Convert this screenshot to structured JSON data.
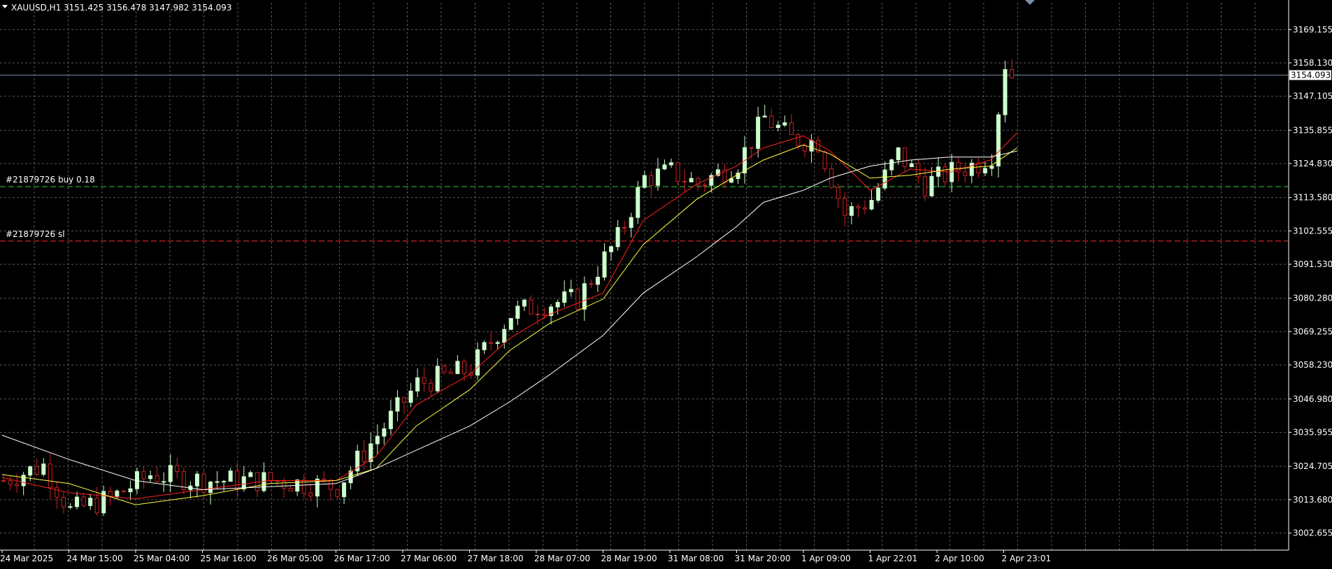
{
  "header": {
    "symbol_label": "XAUUSD,H1",
    "ohlc_label": "3151.425 3156.478 3147.982 3154.093"
  },
  "colors": {
    "background": "#000000",
    "grid": "#5a5a5a",
    "frame": "#ffffff",
    "bull_candle": "#ccffcc",
    "bear_candle": "#cc2222",
    "ma_fast": "#ff2020",
    "ma_mid": "#ffff40",
    "ma_slow": "#ffffff",
    "bid_line": "#7a8ca6",
    "buy_line": "#2ecc40",
    "sl_line": "#ff2a2a"
  },
  "orders": {
    "buy_label": "#21879726 buy 0.18",
    "buy_price": 3117.2,
    "sl_label": "#21879726 sl",
    "sl_price": 3099.2
  },
  "chart_data": {
    "type": "candlestick",
    "symbol": "XAUUSD",
    "timeframe": "H1",
    "current_price": 3154.093,
    "current_price_label": "3154.093",
    "ylim": [
      2997.0,
      3178.0
    ],
    "bar_count": 195,
    "price_ticks": [
      "3169.155",
      "3158.130",
      "3147.105",
      "3135.855",
      "3124.830",
      "3113.580",
      "3102.555",
      "3091.530",
      "3080.280",
      "3069.255",
      "3058.230",
      "3046.980",
      "3035.955",
      "3024.705",
      "3013.680",
      "3002.655"
    ],
    "time_labels": [
      {
        "label": "24 Mar 2025",
        "bar": 0
      },
      {
        "label": "24 Mar 15:00",
        "bar": 10
      },
      {
        "label": "25 Mar 04:00",
        "bar": 20
      },
      {
        "label": "25 Mar 16:00",
        "bar": 30
      },
      {
        "label": "26 Mar 05:00",
        "bar": 40
      },
      {
        "label": "26 Mar 17:00",
        "bar": 50
      },
      {
        "label": "27 Mar 06:00",
        "bar": 60
      },
      {
        "label": "27 Mar 18:00",
        "bar": 70
      },
      {
        "label": "28 Mar 07:00",
        "bar": 80
      },
      {
        "label": "28 Mar 19:00",
        "bar": 90
      },
      {
        "label": "31 Mar 08:00",
        "bar": 100
      },
      {
        "label": "31 Mar 20:00",
        "bar": 110
      },
      {
        "label": "1 Apr 09:00",
        "bar": 120
      },
      {
        "label": "1 Apr 22:01",
        "bar": 130
      },
      {
        "label": "2 Apr 10:00",
        "bar": 140
      },
      {
        "label": "2 Apr 23:01",
        "bar": 150
      }
    ],
    "trend_anchors": [
      [
        0,
        3020
      ],
      [
        6,
        3025
      ],
      [
        10,
        3010
      ],
      [
        16,
        3014
      ],
      [
        22,
        3022
      ],
      [
        30,
        3020
      ],
      [
        40,
        3020
      ],
      [
        50,
        3018
      ],
      [
        56,
        3035
      ],
      [
        62,
        3052
      ],
      [
        70,
        3057
      ],
      [
        76,
        3075
      ],
      [
        80,
        3078
      ],
      [
        86,
        3080
      ],
      [
        92,
        3100
      ],
      [
        96,
        3120
      ],
      [
        100,
        3122
      ],
      [
        104,
        3118
      ],
      [
        110,
        3125
      ],
      [
        114,
        3140
      ],
      [
        118,
        3133
      ],
      [
        122,
        3132
      ],
      [
        126,
        3108
      ],
      [
        130,
        3113
      ],
      [
        134,
        3128
      ],
      [
        138,
        3118
      ],
      [
        142,
        3122
      ],
      [
        146,
        3125
      ],
      [
        148,
        3128
      ],
      [
        150,
        3158
      ],
      [
        151,
        3154
      ]
    ],
    "ma_series": [
      {
        "key": "ma_fast",
        "color": "#ff2020",
        "points": [
          [
            0,
            3021
          ],
          [
            10,
            3016
          ],
          [
            20,
            3014
          ],
          [
            30,
            3017
          ],
          [
            40,
            3020
          ],
          [
            50,
            3020
          ],
          [
            56,
            3028
          ],
          [
            62,
            3045
          ],
          [
            70,
            3055
          ],
          [
            76,
            3067
          ],
          [
            82,
            3075
          ],
          [
            90,
            3082
          ],
          [
            96,
            3106
          ],
          [
            104,
            3118
          ],
          [
            110,
            3124
          ],
          [
            114,
            3130
          ],
          [
            120,
            3134
          ],
          [
            124,
            3129
          ],
          [
            130,
            3116
          ],
          [
            136,
            3123
          ],
          [
            142,
            3122
          ],
          [
            148,
            3126
          ],
          [
            152,
            3135
          ]
        ]
      },
      {
        "key": "ma_mid",
        "color": "#ffff40",
        "points": [
          [
            0,
            3022
          ],
          [
            10,
            3019
          ],
          [
            20,
            3012
          ],
          [
            30,
            3015
          ],
          [
            40,
            3019
          ],
          [
            50,
            3020
          ],
          [
            56,
            3024
          ],
          [
            62,
            3038
          ],
          [
            70,
            3050
          ],
          [
            76,
            3063
          ],
          [
            82,
            3072
          ],
          [
            90,
            3080
          ],
          [
            96,
            3098
          ],
          [
            104,
            3113
          ],
          [
            110,
            3121
          ],
          [
            114,
            3126
          ],
          [
            120,
            3131
          ],
          [
            124,
            3128
          ],
          [
            130,
            3120
          ],
          [
            136,
            3121
          ],
          [
            142,
            3123
          ],
          [
            148,
            3124
          ],
          [
            152,
            3130
          ]
        ]
      },
      {
        "key": "ma_slow",
        "color": "#ffffff",
        "points": [
          [
            0,
            3035
          ],
          [
            10,
            3027
          ],
          [
            20,
            3020
          ],
          [
            30,
            3017
          ],
          [
            40,
            3018
          ],
          [
            50,
            3019
          ],
          [
            56,
            3024
          ],
          [
            62,
            3030
          ],
          [
            70,
            3038
          ],
          [
            76,
            3046
          ],
          [
            82,
            3055
          ],
          [
            90,
            3068
          ],
          [
            96,
            3082
          ],
          [
            104,
            3094
          ],
          [
            110,
            3104
          ],
          [
            114,
            3112
          ],
          [
            120,
            3116
          ],
          [
            124,
            3120
          ],
          [
            130,
            3124
          ],
          [
            136,
            3126
          ],
          [
            142,
            3127
          ],
          [
            148,
            3127
          ],
          [
            152,
            3129
          ]
        ]
      }
    ]
  }
}
